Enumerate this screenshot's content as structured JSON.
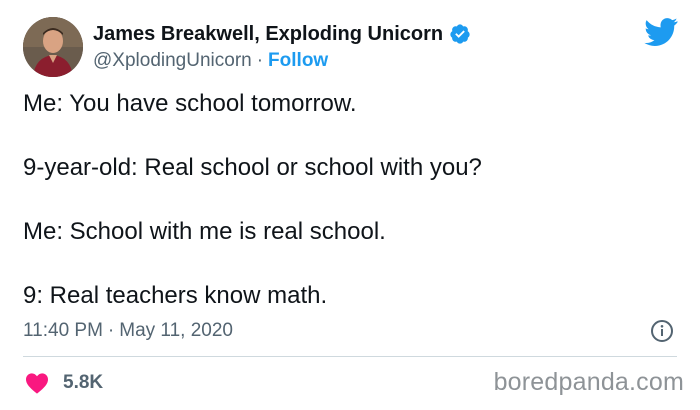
{
  "author": {
    "display_name": "James Breakwell, Exploding Unicorn",
    "handle": "@XplodingUnicorn",
    "separator": "·",
    "follow_label": "Follow",
    "verified": true
  },
  "tweet": {
    "lines": [
      "Me: You have school tomorrow.",
      "9-year-old: Real school or school with you?",
      "Me: School with me is real school.",
      "9: Real teachers know math."
    ],
    "time": "11:40 PM",
    "separator": "·",
    "date": "May 11, 2020",
    "likes": "5.8K"
  },
  "icons": {
    "brand": "twitter-bird-icon",
    "verified": "verified-badge-icon",
    "info": "info-icon",
    "like": "heart-icon"
  },
  "colors": {
    "accent": "#1d9bf0",
    "heart": "#f91880",
    "text_primary": "#0f1419",
    "text_secondary": "#536471",
    "watermark": "#8e9397"
  },
  "watermark": "boredpanda.com"
}
